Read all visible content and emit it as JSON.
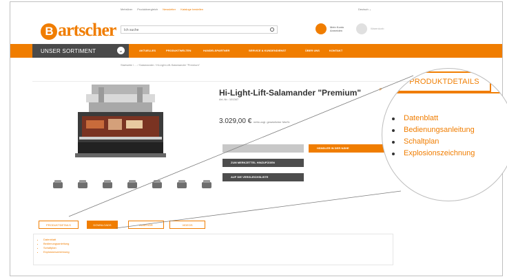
{
  "topbar": {
    "links": [
      "Mehrüber",
      "Produktvergleich",
      "Newsletter",
      "Kataloge bestellen"
    ],
    "language": "Deutsch"
  },
  "logo": {
    "letter": "B",
    "rest": "artscher"
  },
  "search": {
    "placeholder": "Ich suche"
  },
  "user": {
    "line1": "Mein Konto",
    "line2": "Anmelden"
  },
  "cart": {
    "label": "Warenkorb"
  },
  "nav": {
    "sortiment": "UNSER SORTIMENT",
    "items": [
      "AKTUELLES",
      "PRODUKTWELTEN",
      "HANDELSPARTNER",
      "SERVICE & KUNDENDIENST",
      "ÜBER UNS",
      "KONTAKT"
    ]
  },
  "breadcrumb": "Startseite  /  ...  /  Salamander  /  Hi-Light-Lift-Salamander \"Premium\"",
  "product": {
    "title": "Hi-Light-Lift-Salamander \"Premium\"",
    "artnr": "Art.-Nr.: 101347",
    "price": "3.029,00 €",
    "price_note": "netto zzgl. gesetzlicher MwSt."
  },
  "buttons": {
    "händler": "HÄNDLER IN DER NÄHE",
    "merkzettel": "ZUM MERKZETTEL HINZUFÜGEN",
    "vergleich": "AUF DIE VERGLEICHSLISTE"
  },
  "tabs": [
    "PRODUKTDETAILS",
    "DOWNLOADS",
    "ZUBEHÖR",
    "VIDEOS"
  ],
  "downloads": [
    "Datenblatt",
    "Bedienungsanleitung",
    "Schaltplan",
    "Explosionszeichnung"
  ],
  "zoom": {
    "tab": "PRODUKTDETAILS",
    "items": [
      "Datenblatt",
      "Bedienungsanleitung",
      "Schaltplan",
      "Explosionszeichnung"
    ]
  }
}
